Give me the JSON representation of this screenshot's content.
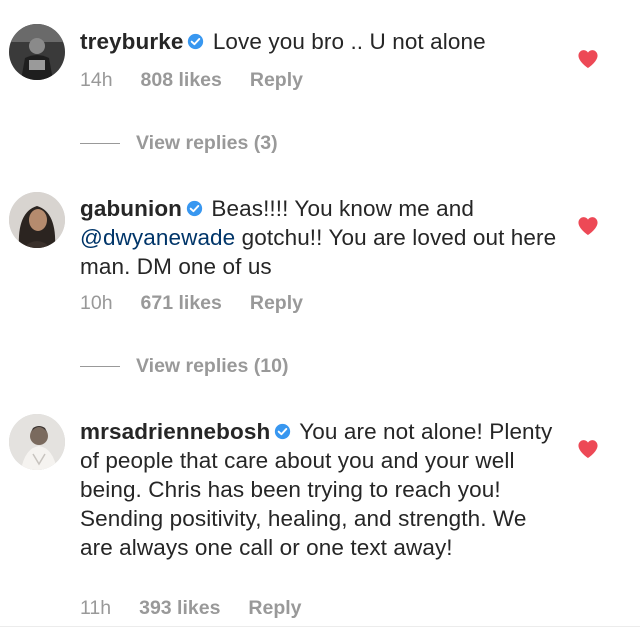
{
  "colors": {
    "heart": "#ed4956",
    "verified": "#3897f0",
    "meta": "#999999",
    "mention": "#003569",
    "text": "#262626"
  },
  "comments": [
    {
      "username": "treyburke",
      "verified": true,
      "text_parts": [
        {
          "text": "Love you bro .. U not alone",
          "type": "text"
        }
      ],
      "time": "14h",
      "likes": "808 likes",
      "reply": "Reply",
      "liked": true,
      "avatar_icon": "profile-photo",
      "view_replies": "View replies (3)"
    },
    {
      "username": "gabunion",
      "verified": true,
      "text_parts": [
        {
          "text": "Beas!!!! You know me and ",
          "type": "text"
        },
        {
          "text": "@dwyanewade",
          "type": "mention"
        },
        {
          "text": " gotchu!! You are loved out here man. DM one of us",
          "type": "text"
        }
      ],
      "time": "10h",
      "likes": "671 likes",
      "reply": "Reply",
      "liked": true,
      "avatar_icon": "profile-photo",
      "view_replies": "View replies (10)"
    },
    {
      "username": "mrsadriennebosh",
      "verified": true,
      "text_parts": [
        {
          "text": "You are not alone! Plenty of people that care about you and your well being. Chris has been trying to reach you! Sending positivity, healing, and strength. We are always one call or one text away!",
          "type": "text"
        }
      ],
      "time": "11h",
      "likes": "393 likes",
      "reply": "Reply",
      "liked": true,
      "avatar_icon": "profile-photo"
    }
  ]
}
